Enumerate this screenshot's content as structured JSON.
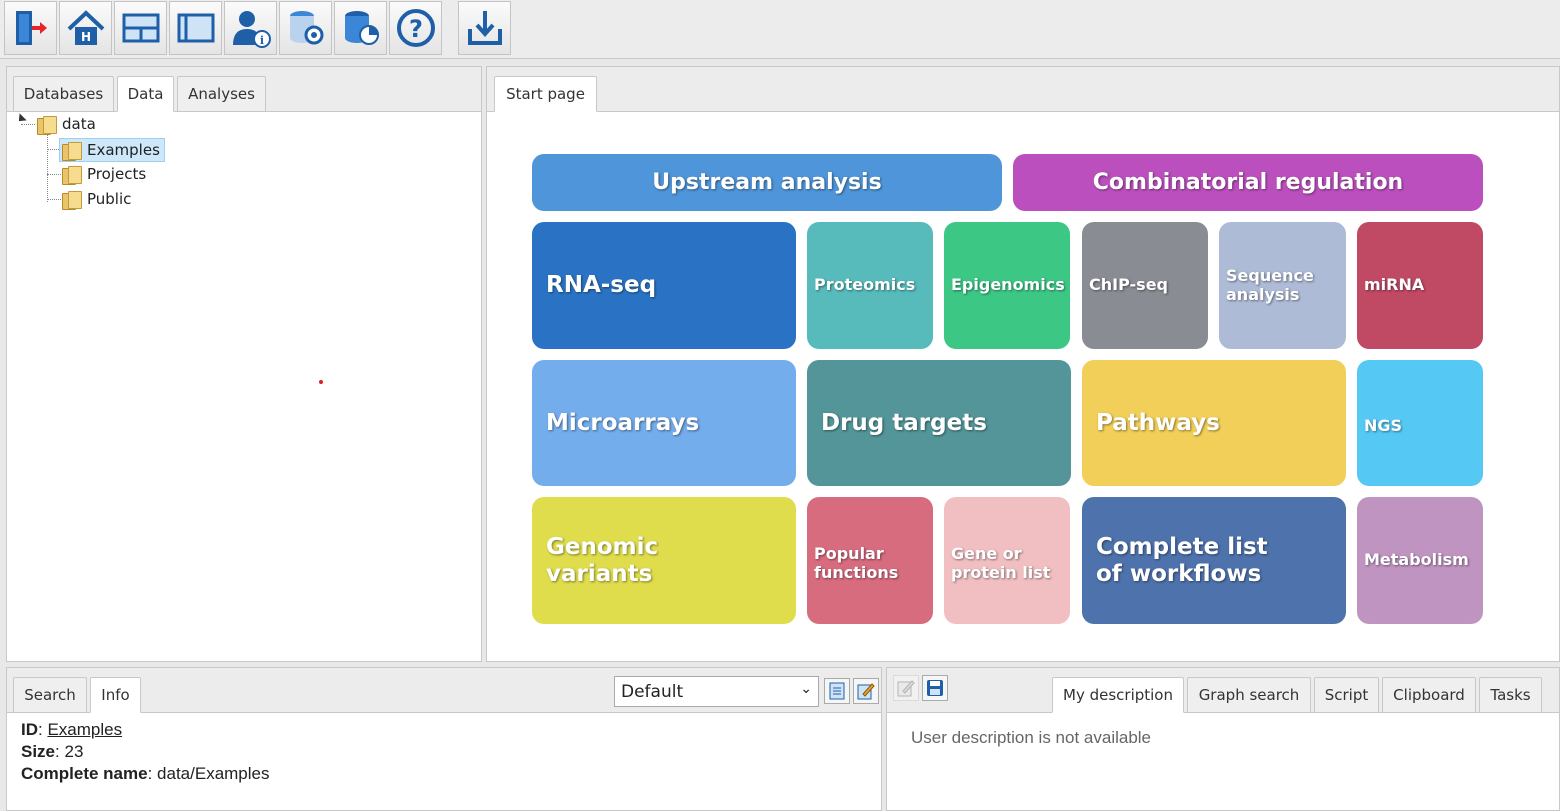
{
  "toolbar": {
    "buttons": [
      {
        "name": "logout-icon"
      },
      {
        "name": "home-icon"
      },
      {
        "name": "layout-split-icon"
      },
      {
        "name": "layout-panel-icon"
      },
      {
        "name": "user-info-icon"
      },
      {
        "name": "database-settings-icon"
      },
      {
        "name": "database-analysis-icon"
      },
      {
        "name": "help-icon"
      },
      {
        "name": "import-icon"
      }
    ]
  },
  "left_panel": {
    "tabs": [
      "Databases",
      "Data",
      "Analyses"
    ],
    "active_tab": "Data",
    "tree": {
      "root": "data",
      "children": [
        "Examples",
        "Projects",
        "Public"
      ],
      "selected": "Examples"
    }
  },
  "main_panel": {
    "tabs": [
      "Start page"
    ],
    "headers": {
      "upstream": {
        "label": "Upstream analysis",
        "color": "#4f95d9"
      },
      "combinatorial": {
        "label": "Combinatorial regulation",
        "color": "#bb4fbd"
      }
    },
    "tiles": {
      "rna_seq": {
        "label": "RNA-seq",
        "color": "#2a73c4"
      },
      "proteomics": {
        "label": "Proteomics",
        "color": "#57bbbb"
      },
      "epigenomics": {
        "label": "Epigenomics",
        "color": "#3cc785"
      },
      "chip_seq": {
        "label": "ChIP-seq",
        "color": "#8a8c94"
      },
      "sequence_analysis": {
        "label": "Sequence analysis",
        "color": "#aebbd6"
      },
      "mirna": {
        "label": "miRNA",
        "color": "#c04964"
      },
      "microarrays": {
        "label": "Microarrays",
        "color": "#74adec"
      },
      "drug_targets": {
        "label": "Drug targets",
        "color": "#539598"
      },
      "pathways": {
        "label": "Pathways",
        "color": "#f2cf59"
      },
      "ngs": {
        "label": "NGS",
        "color": "#56c8f4"
      },
      "genomic_variants": {
        "label": "Genomic variants",
        "color": "#dfdd4b"
      },
      "popular_functions": {
        "label": "Popular functions",
        "color": "#d86c7f"
      },
      "gene_protein_list": {
        "label": "Gene or protein list",
        "color": "#f1bfc2"
      },
      "complete_workflows": {
        "label": "Complete list of workflows",
        "color": "#4e72ac"
      },
      "metabolism": {
        "label": "Metabolism",
        "color": "#c094c0"
      }
    }
  },
  "info_panel": {
    "tabs": [
      "Search",
      "Info"
    ],
    "active_tab": "Info",
    "view_select": "Default",
    "id_label": "ID",
    "id_value": "Examples",
    "size_label": "Size",
    "size_value": "23",
    "complete_name_label": "Complete name",
    "complete_name_value": "data/Examples"
  },
  "description_panel": {
    "tabs": [
      "My description",
      "Graph search",
      "Script",
      "Clipboard",
      "Tasks"
    ],
    "active_tab": "My description",
    "message": "User description is not available"
  }
}
